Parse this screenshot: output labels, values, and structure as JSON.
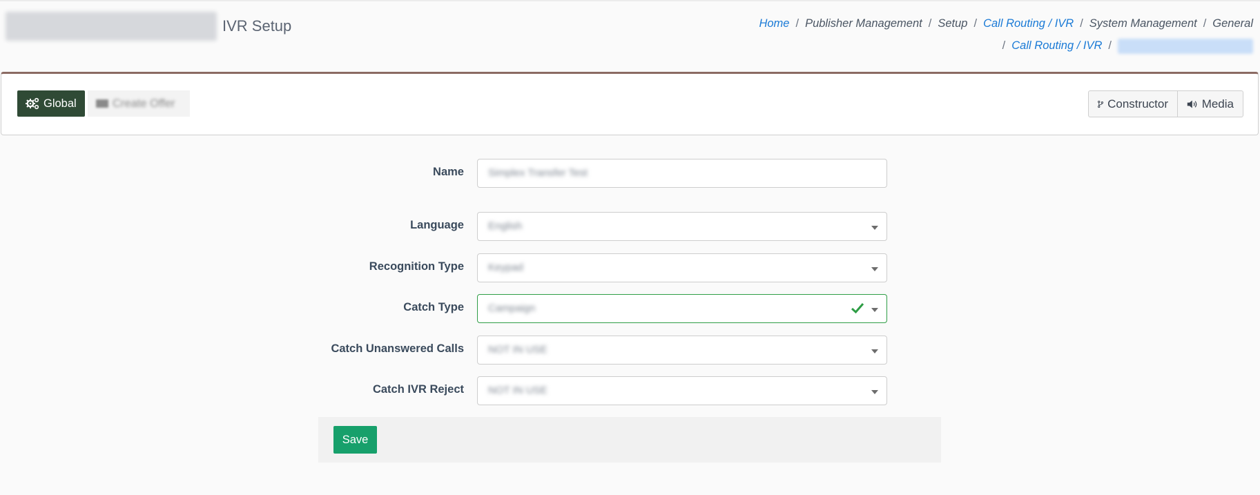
{
  "header": {
    "title_suffix": "IVR Setup",
    "breadcrumb": {
      "home": "Home",
      "publisher_management": "Publisher Management",
      "setup": "Setup",
      "call_routing_ivr": "Call Routing / IVR",
      "system_management": "System Management",
      "general": "General",
      "call_routing_ivr_2": "Call Routing / IVR",
      "separator": "/"
    }
  },
  "toolbar": {
    "global_label": "Global",
    "create_offer_label": "Create Offer",
    "constructor_label": "Constructor",
    "media_label": "Media",
    "global_color": "#2f4a35"
  },
  "form": {
    "name_label": "Name",
    "name_value": "Simplex Transfer Test",
    "language_label": "Language",
    "language_value": "English",
    "recognition_type_label": "Recognition Type",
    "recognition_type_value": "Keypad",
    "catch_type_label": "Catch Type",
    "catch_type_value": "Campaign",
    "catch_unanswered_label": "Catch Unanswered Calls",
    "catch_unanswered_value": "NOT IN USE",
    "catch_ivr_reject_label": "Catch IVR Reject",
    "catch_ivr_reject_value": "NOT IN USE",
    "save_label": "Save",
    "save_color": "#17a06b",
    "valid_color": "#2e9d45"
  }
}
